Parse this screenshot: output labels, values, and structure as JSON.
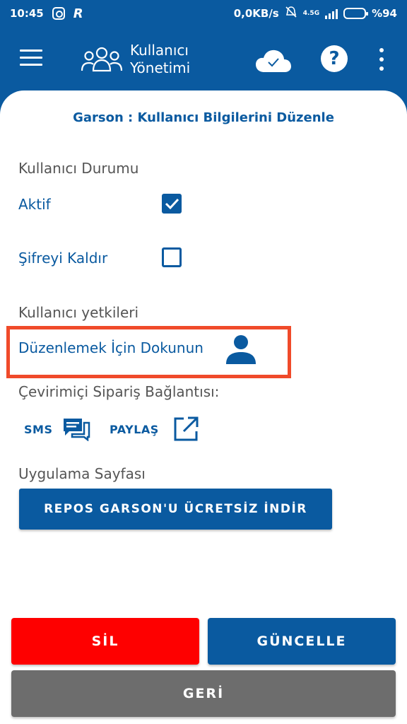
{
  "status_bar": {
    "time": "10:45",
    "network_speed": "0,0KB/s",
    "network_type": "4.5G",
    "battery": "%94"
  },
  "app_bar": {
    "title_line1": "Kullanıcı",
    "title_line2": "Yönetimi",
    "help_label": "?"
  },
  "form": {
    "title": "Garson : Kullanıcı Bilgilerini Düzenle",
    "status_section": "Kullanıcı Durumu",
    "active_label": "Aktif",
    "active_checked": true,
    "remove_password_label": "Şifreyi Kaldır",
    "remove_password_checked": false,
    "permissions_section": "Kullanıcı yetkileri",
    "edit_permissions_label": "Düzenlemek İçin Dokunun",
    "online_order_section": "Çevirimiçi Sipariş Bağlantısı:",
    "sms_label": "SMS",
    "share_label": "PAYLAŞ",
    "app_page_section": "Uygulama Sayfası",
    "download_label": "REPOS GARSON'U ÜCRETSİZ İNDİR"
  },
  "actions": {
    "delete_label": "SİL",
    "update_label": "GÜNCELLE",
    "back_label": "GERİ"
  },
  "colors": {
    "primary": "#0a5aa0",
    "delete": "#fe0000",
    "back": "#6d6d6d",
    "highlight": "#f04a2a"
  }
}
